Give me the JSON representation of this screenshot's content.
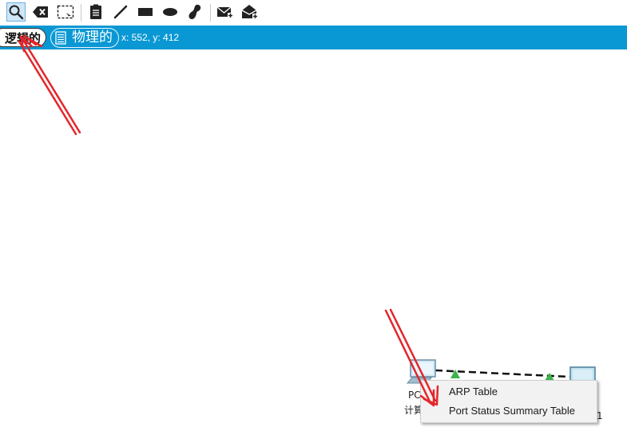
{
  "toolbar": {
    "tools": [
      {
        "icon": "inspect-magnifier-icon",
        "active": true
      },
      {
        "icon": "delete-icon"
      },
      {
        "icon": "resize-selection-icon"
      },
      {
        "icon": "place-note-icon"
      },
      {
        "icon": "draw-line-icon"
      },
      {
        "icon": "draw-rectangle-icon"
      },
      {
        "icon": "draw-ellipse-icon"
      },
      {
        "icon": "freeform-shape-icon"
      },
      {
        "icon": "add-simple-pdu-icon"
      },
      {
        "icon": "add-complex-pdu-icon"
      }
    ]
  },
  "tabs": {
    "logical_label": "逻辑的",
    "physical_label": "物理的"
  },
  "status": {
    "coordinates": "x: 552, y: 412"
  },
  "topology": {
    "pc_label_line1": "PC",
    "pc_label_line2": "计算",
    "right_node_label": "1",
    "link_status_color": "#3cb44b"
  },
  "context_menu": {
    "items": [
      "ARP Table",
      "Port Status Summary Table"
    ]
  },
  "colors": {
    "accent_bar": "#0a98d4",
    "annotation_arrow": "#e3262b"
  }
}
